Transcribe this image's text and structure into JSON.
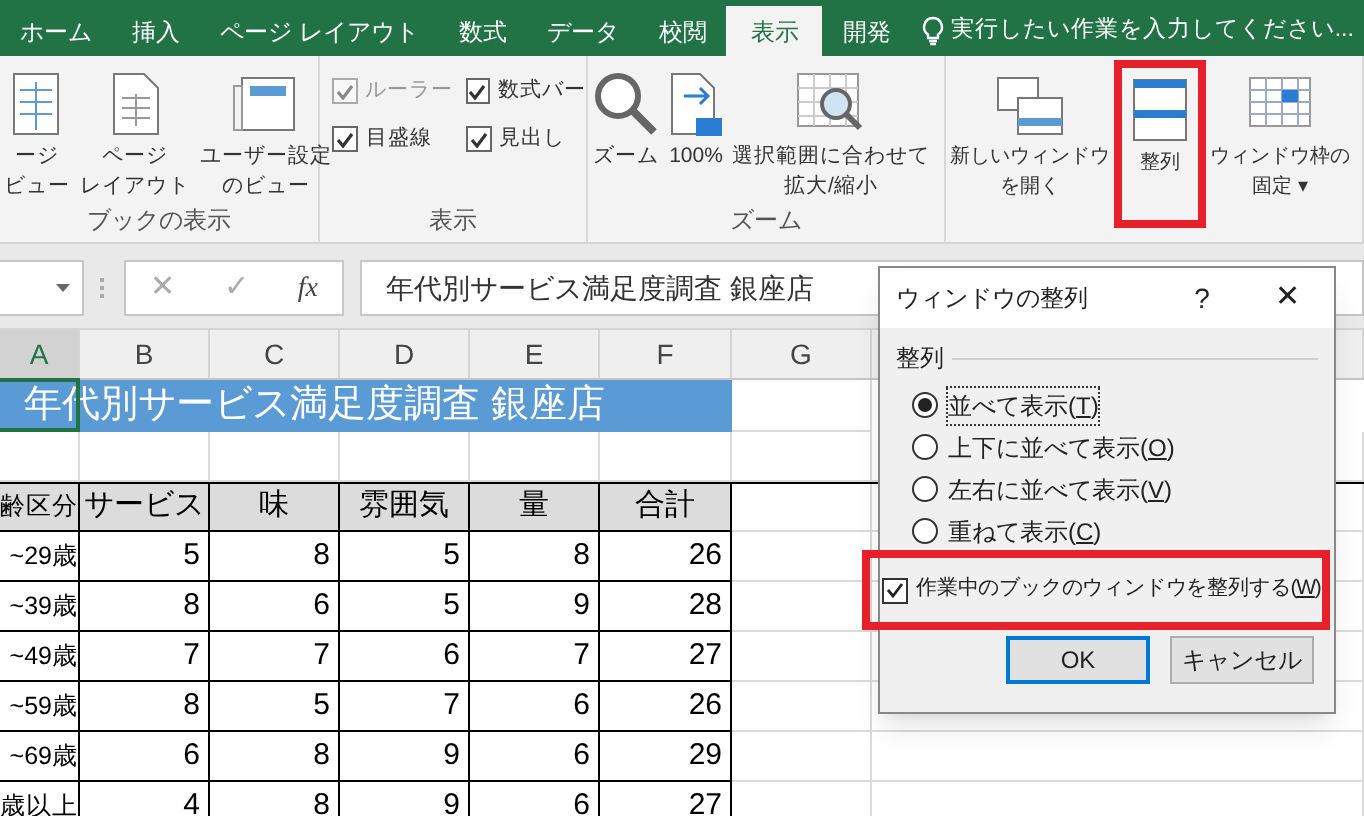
{
  "tabs": [
    {
      "label": "ホーム",
      "selected": false
    },
    {
      "label": "挿入",
      "selected": false
    },
    {
      "label": "ページ レイアウト",
      "selected": false
    },
    {
      "label": "数式",
      "selected": false
    },
    {
      "label": "データ",
      "selected": false
    },
    {
      "label": "校閲",
      "selected": false
    },
    {
      "label": "表示",
      "selected": true
    },
    {
      "label": "開発",
      "selected": false
    }
  ],
  "tell_me": "実行したい作業を入力してください...",
  "ribbon_groups": [
    {
      "label": "ブックの表示",
      "items": [
        {
          "kind": "button",
          "lines": [
            "ージ",
            "ビュー"
          ]
        },
        {
          "kind": "button",
          "lines": [
            "ページ",
            "レイアウト"
          ]
        },
        {
          "kind": "button",
          "lines": [
            "ユーザー設定",
            "のビュー"
          ]
        }
      ]
    },
    {
      "label": "表示",
      "items": [
        {
          "kind": "checkbox",
          "label": "ルーラー",
          "checked": true,
          "disabled": true
        },
        {
          "kind": "checkbox",
          "label": "数式バー",
          "checked": true,
          "disabled": false
        },
        {
          "kind": "checkbox",
          "label": "目盛線",
          "checked": true,
          "disabled": false
        },
        {
          "kind": "checkbox",
          "label": "見出し",
          "checked": true,
          "disabled": false
        }
      ]
    },
    {
      "label": "ズーム",
      "items": [
        {
          "kind": "button",
          "lines": [
            "ズーム"
          ]
        },
        {
          "kind": "button",
          "lines": [
            "100%"
          ]
        },
        {
          "kind": "button",
          "lines": [
            "選択範囲に合わせて",
            "拡大/縮小"
          ]
        }
      ]
    },
    {
      "items": [
        {
          "kind": "button",
          "lines": [
            "新しいウィンドウ",
            "を開く"
          ]
        },
        {
          "kind": "button",
          "lines": [
            "整列"
          ],
          "highlighted": true
        },
        {
          "kind": "button",
          "lines": [
            "ウィンドウ枠の",
            "固定 ▾"
          ]
        }
      ]
    }
  ],
  "formula_bar": {
    "cancel": "✕",
    "enter": "✓",
    "function": "fx",
    "value": "年代別サービス満足度調査 銀座店"
  },
  "columns": [
    "A",
    "B",
    "C",
    "D",
    "E",
    "F",
    "G"
  ],
  "sheet_title": "年代別サービス満足度調査 銀座店",
  "table_header": [
    "齢区分",
    "サービス",
    "味",
    "雰囲気",
    "量",
    "合計"
  ],
  "table_rows": [
    [
      "~29歳",
      "5",
      "8",
      "5",
      "8",
      "26"
    ],
    [
      "~39歳",
      "8",
      "6",
      "5",
      "9",
      "28"
    ],
    [
      "~49歳",
      "7",
      "7",
      "6",
      "7",
      "27"
    ],
    [
      "~59歳",
      "8",
      "5",
      "7",
      "6",
      "26"
    ],
    [
      "~69歳",
      "6",
      "8",
      "9",
      "6",
      "29"
    ],
    [
      "歳以上",
      "4",
      "8",
      "9",
      "6",
      "27"
    ]
  ],
  "dialog": {
    "title": "ウィンドウの整列",
    "help": "?",
    "close": "✕",
    "group": "整列",
    "options": [
      {
        "text": "並べて表示(",
        "accel": "T",
        "tail": ")",
        "selected": true
      },
      {
        "text": "上下に並べて表示(",
        "accel": "O",
        "tail": ")",
        "selected": false
      },
      {
        "text": "左右に並べて表示(",
        "accel": "V",
        "tail": ")",
        "selected": false
      },
      {
        "text": "重ねて表示(",
        "accel": "C",
        "tail": ")",
        "selected": false
      }
    ],
    "checkbox": {
      "text": "作業中のブックのウィンドウを整列する(",
      "accel": "W",
      "tail": ")",
      "checked": true,
      "highlighted": true
    },
    "buttons": [
      {
        "label": "OK",
        "default": true
      },
      {
        "label": "キャンセル",
        "default": false
      }
    ]
  }
}
